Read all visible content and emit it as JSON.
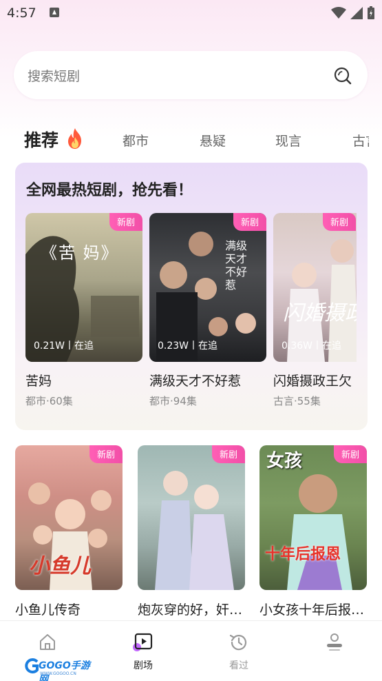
{
  "status_bar": {
    "time": "4:57"
  },
  "search": {
    "placeholder": "搜索短剧"
  },
  "tabs": {
    "active": "推荐",
    "items": [
      "都市",
      "悬疑",
      "现言",
      "古言"
    ]
  },
  "hot": {
    "title": "全网最热短剧，抢先看！",
    "cards": [
      {
        "title": "苦妈",
        "meta": "都市·60集",
        "stats": "0.21W丨在追",
        "badge": "新剧",
        "poster_text": "《苦 妈》"
      },
      {
        "title": "满级天才不好惹",
        "meta": "都市·94集",
        "stats": "0.23W丨在追",
        "badge": "新剧",
        "poster_text": "满级天才不好惹"
      },
      {
        "title": "闪婚摄政王欠",
        "meta": "古言·55集",
        "stats": "0.36W丨在追",
        "badge": "新剧",
        "poster_text": "闪婚摄政"
      }
    ]
  },
  "grid": [
    {
      "title": "小鱼儿传奇",
      "badge": "新剧",
      "poster_text": "小鱼儿"
    },
    {
      "title": "炮灰穿的好，奸…",
      "badge": "新剧",
      "poster_text": ""
    },
    {
      "title": "小女孩十年后报…",
      "badge": "新剧",
      "poster_text": "十年后报恩"
    }
  ],
  "nav": {
    "home": "",
    "theater": "剧场",
    "history": "看过",
    "profile": ""
  },
  "watermark": {
    "brand": "GOGO手游网",
    "url": "WWW.GOGOO.CN"
  },
  "colors": {
    "badge": "#f24fa8",
    "accent": "#ff5fb5",
    "flame": "#ff5a3c"
  }
}
